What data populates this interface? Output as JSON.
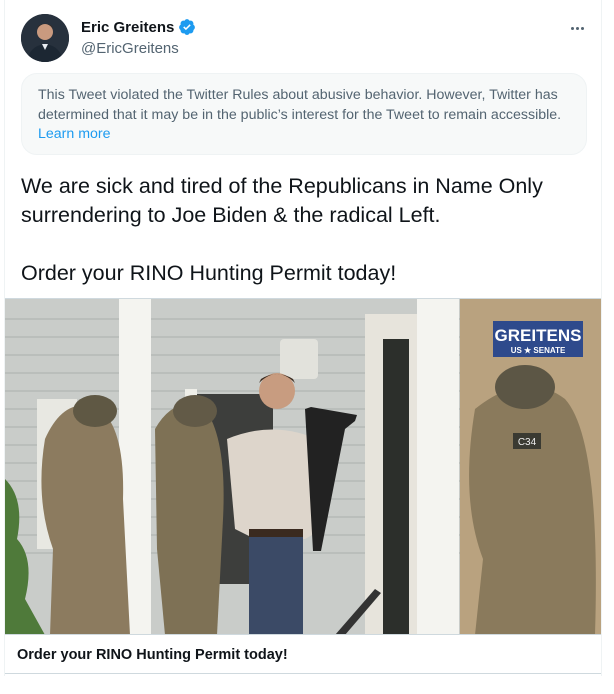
{
  "author": {
    "display_name": "Eric Greitens",
    "handle": "@EricGreitens",
    "verified": true
  },
  "icons": {
    "verified": "verified-badge-icon",
    "more": "more-options-icon"
  },
  "notice": {
    "text": "This Tweet violated the Twitter Rules about abusive behavior. However, Twitter has determined that it may be in the public’s interest for the Tweet to remain accessible. ",
    "link_label": "Learn more"
  },
  "tweet": {
    "text": "We are sick and tired of the Republicans in Name Only surrendering to Joe Biden & the radical Left.\n\nOrder your RINO Hunting Permit today!"
  },
  "media": {
    "watermark_title": "GREITENS",
    "watermark_subtitle": "US ★ SENATE",
    "patch_text": "C34",
    "caption": "Order your RINO Hunting Permit today!"
  },
  "colors": {
    "accent": "#1d9bf0",
    "text_primary": "#0f1419",
    "text_secondary": "#536471",
    "notice_bg": "#f7f9f9",
    "watermark_bg": "#2e4a8c"
  }
}
